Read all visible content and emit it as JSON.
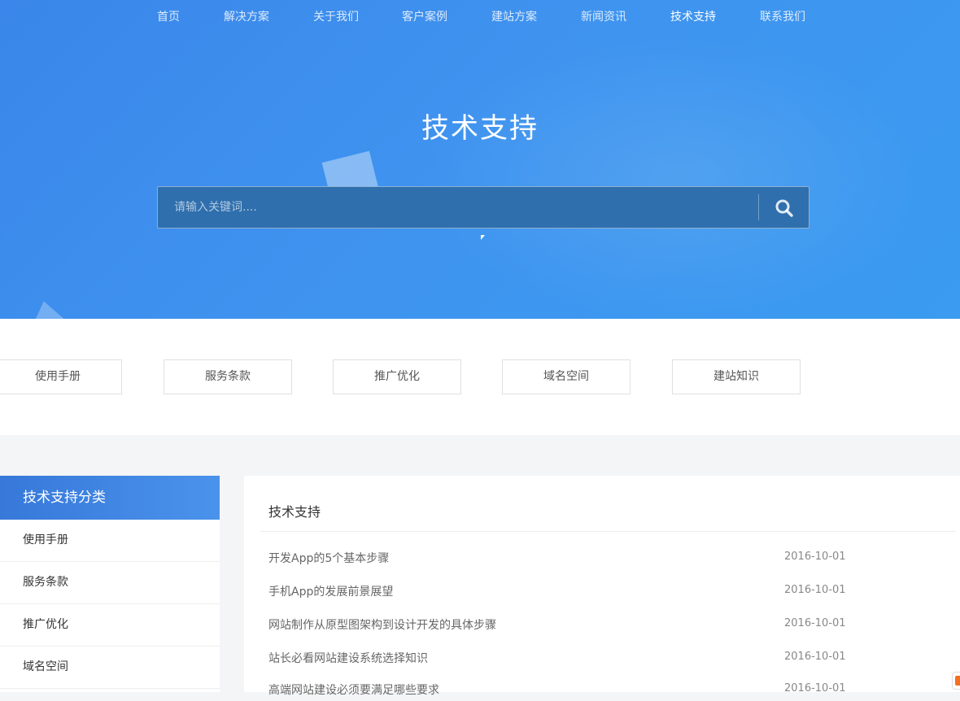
{
  "nav": {
    "items": [
      {
        "label": "首页"
      },
      {
        "label": "解决方案"
      },
      {
        "label": "关于我们"
      },
      {
        "label": "客户案例"
      },
      {
        "label": "建站方案"
      },
      {
        "label": "新闻资讯"
      },
      {
        "label": "技术支持"
      },
      {
        "label": "联系我们"
      }
    ],
    "active": "技术支持"
  },
  "hero": {
    "title": "技术支持",
    "search": {
      "placeholder": "请输入关键词....",
      "value": "",
      "button_icon": "search-icon"
    }
  },
  "categories": [
    {
      "label": "使用手册"
    },
    {
      "label": "服务条款"
    },
    {
      "label": "推广优化"
    },
    {
      "label": "域名空间"
    },
    {
      "label": "建站知识"
    }
  ],
  "sidebar": {
    "title": "技术支持分类",
    "items": [
      {
        "label": "使用手册"
      },
      {
        "label": "服务条款"
      },
      {
        "label": "推广优化"
      },
      {
        "label": "域名空间"
      }
    ]
  },
  "main": {
    "title": "技术支持",
    "articles": [
      {
        "title": "开发App的5个基本步骤",
        "date": "2016-10-01"
      },
      {
        "title": "手机App的发展前景展望",
        "date": "2016-10-01"
      },
      {
        "title": "网站制作从原型图架构到设计开发的具体步骤",
        "date": "2016-10-01"
      },
      {
        "title": "站长必看网站建设系统选择知识",
        "date": "2016-10-01"
      },
      {
        "title": "高端网站建设必须要满足哪些要求",
        "date": "2016-10-01"
      }
    ]
  },
  "colors": {
    "hero_blue": "#3f93ef",
    "search_bg": "#2f6fad",
    "sidebar_head": "#3778d9",
    "page_bg": "#f4f5f7"
  }
}
